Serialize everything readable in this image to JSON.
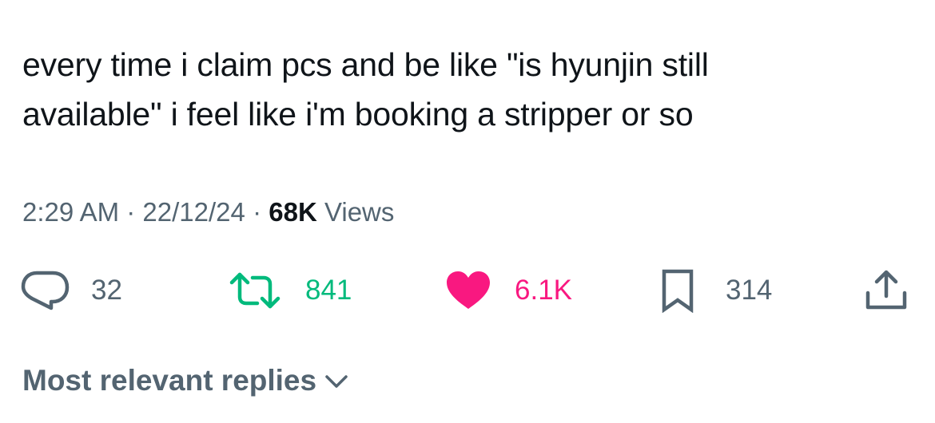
{
  "tweet": {
    "text_line1": "every time i claim pcs and be like \"is hyunjin still",
    "text_line2": "available\" i feel like i'm booking a stripper or so",
    "time": "2:29 AM",
    "separator": "·",
    "date": "22/12/24",
    "views_count": "68K",
    "views_label": "Views"
  },
  "actions": {
    "replies": "32",
    "retweets": "841",
    "likes": "6.1K",
    "bookmarks": "314"
  },
  "replies_sort": {
    "label": "Most relevant replies"
  },
  "icons": {
    "reply": "speech-bubble-icon",
    "retweet": "retweet-icon",
    "like": "heart-icon",
    "bookmark": "bookmark-icon",
    "share": "share-upload-icon",
    "sort": "chevron-down-icon"
  },
  "colors": {
    "text": "#0f1419",
    "muted": "#536471",
    "retweet": "#00ba7c",
    "like": "#f91880"
  }
}
